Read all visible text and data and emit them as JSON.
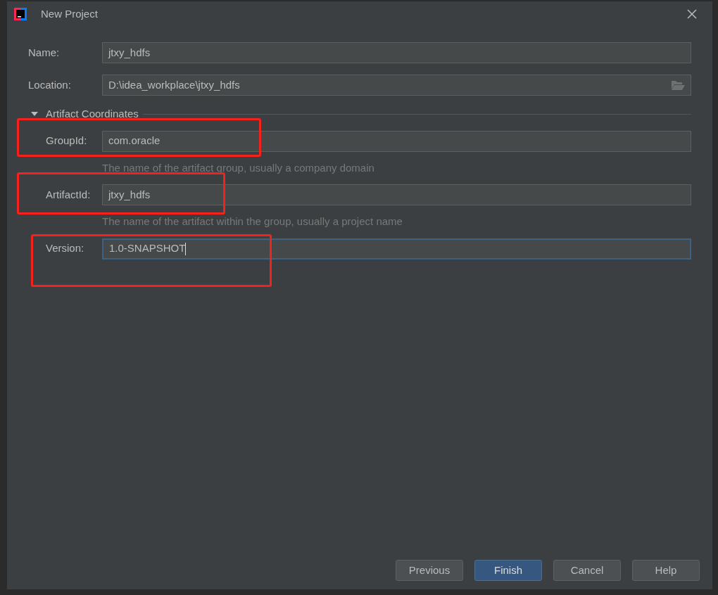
{
  "window": {
    "title": "New Project"
  },
  "fields": [
    {
      "label": "Name:",
      "value": "jtxy_hdfs",
      "kind": "text",
      "focused": false
    },
    {
      "label": "Location:",
      "value": "D:\\idea_workplace\\jtxy_hdfs",
      "kind": "folder",
      "focused": false
    }
  ],
  "section": {
    "title": "Artifact Coordinates",
    "expanded": true,
    "fields": [
      {
        "label": "GroupId:",
        "value": "com.oracle",
        "hint": "The name of the artifact group, usually a company domain",
        "focused": false,
        "highlighted": true
      },
      {
        "label": "ArtifactId:",
        "value": "jtxy_hdfs",
        "hint": "The name of the artifact within the group, usually a project name",
        "focused": false,
        "highlighted": true
      },
      {
        "label": "Version:",
        "value": "1.0-SNAPSHOT",
        "focused": true,
        "highlighted": true
      }
    ]
  },
  "buttons": [
    {
      "label": "Previous",
      "default": false
    },
    {
      "label": "Finish",
      "default": true
    },
    {
      "label": "Cancel",
      "default": false
    },
    {
      "label": "Help",
      "default": false
    }
  ]
}
